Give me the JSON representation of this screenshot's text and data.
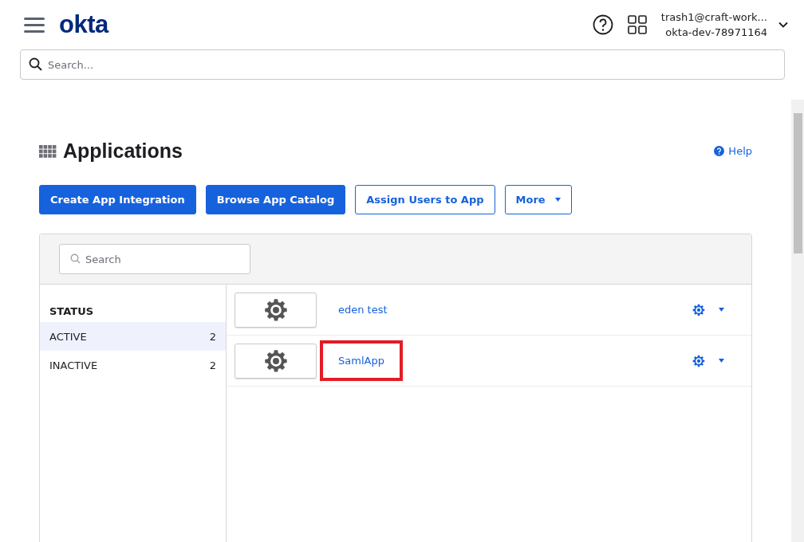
{
  "header": {
    "logo": "okta",
    "user_email": "trash1@craft-work...",
    "org": "okta-dev-78971164"
  },
  "search": {
    "placeholder": "Search..."
  },
  "page": {
    "title": "Applications",
    "help": "Help"
  },
  "buttons": [
    {
      "label": "Create App Integration",
      "kind": "primary"
    },
    {
      "label": "Browse App Catalog",
      "kind": "primary"
    },
    {
      "label": "Assign Users to App",
      "kind": "secondary"
    },
    {
      "label": "More",
      "kind": "dropdown"
    }
  ],
  "filter": {
    "placeholder": "Search"
  },
  "status": {
    "heading": "STATUS",
    "items": [
      {
        "label": "ACTIVE",
        "count": "2",
        "selected": true
      },
      {
        "label": "INACTIVE",
        "count": "2",
        "selected": false
      }
    ]
  },
  "apps": [
    {
      "name": "eden test",
      "highlighted": false
    },
    {
      "name": "SamlApp",
      "highlighted": true
    }
  ]
}
